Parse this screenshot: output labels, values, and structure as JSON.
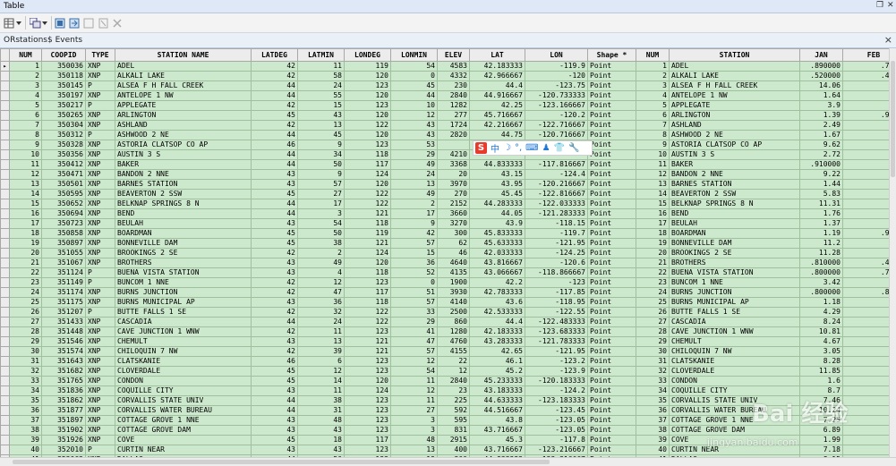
{
  "window": {
    "title": "Table"
  },
  "tab": {
    "title": "ORstations$ Events",
    "close": "×"
  },
  "ime": {
    "logo": "S",
    "items": [
      "中",
      "☽",
      "°,",
      "⌨",
      "♟",
      "👕",
      "🔧"
    ]
  },
  "watermark": {
    "text": "Bai 经验",
    "url": "jingyan.baidu.com"
  },
  "columns": [
    "NUM",
    "COOPID",
    "TYPE",
    "STATION NAME",
    "LATDEG",
    "LATMIN",
    "LONDEG",
    "LONMIN",
    "ELEV",
    "LAT",
    "LON",
    "Shape *",
    "NUM",
    "STATION",
    "JAN",
    "FEB"
  ],
  "rows": [
    [
      "1",
      "350036",
      "XNP",
      "ADEL",
      "42",
      "11",
      "119",
      "54",
      "4583",
      "42.183333",
      "-119.9",
      "Point",
      "1",
      "ADEL",
      ".890000",
      ".7900"
    ],
    [
      "2",
      "350118",
      "XNP",
      "ALKALI LAKE",
      "42",
      "58",
      "120",
      "0",
      "4332",
      "42.966667",
      "-120",
      "Point",
      "2",
      "ALKALI LAKE",
      ".520000",
      ".4600"
    ],
    [
      "3",
      "350145",
      "P",
      "ALSEA F H FALL CREEK",
      "44",
      "24",
      "123",
      "45",
      "230",
      "44.4",
      "-123.75",
      "Point",
      "3",
      "ALSEA F H FALL CREEK",
      "14.06",
      "12."
    ],
    [
      "4",
      "350197",
      "XNP",
      "ANTELOPE 1 NW",
      "44",
      "55",
      "120",
      "44",
      "2840",
      "44.916667",
      "-120.733333",
      "Point",
      "4",
      "ANTELOPE 1 NW",
      "1.64",
      "1."
    ],
    [
      "5",
      "350217",
      "P",
      "APPLEGATE",
      "42",
      "15",
      "123",
      "10",
      "1282",
      "42.25",
      "-123.166667",
      "Point",
      "5",
      "APPLEGATE",
      "3.9",
      "3."
    ],
    [
      "6",
      "350265",
      "XNP",
      "ARLINGTON",
      "45",
      "43",
      "120",
      "12",
      "277",
      "45.716667",
      "-120.2",
      "Point",
      "6",
      "ARLINGTON",
      "1.39",
      ".9900"
    ],
    [
      "7",
      "350304",
      "XNP",
      "ASHLAND",
      "42",
      "13",
      "122",
      "43",
      "1724",
      "42.216667",
      "-122.716667",
      "Point",
      "7",
      "ASHLAND",
      "2.49",
      "1."
    ],
    [
      "8",
      "350312",
      "P",
      "ASHWOOD 2 NE",
      "44",
      "45",
      "120",
      "43",
      "2820",
      "44.75",
      "-120.716667",
      "Point",
      "8",
      "ASHWOOD 2 NE",
      "1.67",
      "1."
    ],
    [
      "9",
      "350328",
      "XNP",
      "ASTORIA CLATSOP CO AP",
      "46",
      "9",
      "123",
      "53",
      "",
      "",
      "",
      "Point",
      "9",
      "ASTORIA CLATSOP CO AP",
      "9.62",
      "7."
    ],
    [
      "10",
      "350356",
      "XNP",
      "AUSTIN 3 S",
      "44",
      "34",
      "118",
      "29",
      "4210",
      "",
      "",
      "Point",
      "10",
      "AUSTIN 3 S",
      "2.72",
      "1."
    ],
    [
      "11",
      "350412",
      "XNP",
      "BAKER",
      "44",
      "50",
      "117",
      "49",
      "3368",
      "44.833333",
      "-117.816667",
      "Point",
      "11",
      "BAKER",
      ".910000",
      ""
    ],
    [
      "12",
      "350471",
      "XNP",
      "BANDON 2 NNE",
      "43",
      "9",
      "124",
      "24",
      "20",
      "43.15",
      "-124.4",
      "Point",
      "12",
      "BANDON 2 NNE",
      "9.22",
      "7."
    ],
    [
      "13",
      "350501",
      "XNP",
      "BARNES STATION",
      "43",
      "57",
      "120",
      "13",
      "3970",
      "43.95",
      "-120.216667",
      "Point",
      "13",
      "BARNES STATION",
      "1.44",
      "1."
    ],
    [
      "14",
      "350595",
      "XNP",
      "BEAVERTON 2 SSW",
      "45",
      "27",
      "122",
      "49",
      "270",
      "45.45",
      "-122.816667",
      "Point",
      "14",
      "BEAVERTON 2 SSW",
      "5.83",
      "4."
    ],
    [
      "15",
      "350652",
      "XNP",
      "BELKNAP SPRINGS 8 N",
      "44",
      "17",
      "122",
      "2",
      "2152",
      "44.283333",
      "-122.033333",
      "Point",
      "15",
      "BELKNAP SPRINGS 8 N",
      "11.31",
      "9."
    ],
    [
      "16",
      "350694",
      "XNP",
      "BEND",
      "44",
      "3",
      "121",
      "17",
      "3660",
      "44.05",
      "-121.283333",
      "Point",
      "16",
      "BEND",
      "1.76",
      "1."
    ],
    [
      "17",
      "350723",
      "XNP",
      "BEULAH",
      "43",
      "54",
      "118",
      "9",
      "3270",
      "43.9",
      "-118.15",
      "Point",
      "17",
      "BEULAH",
      "1.37",
      "1."
    ],
    [
      "18",
      "350858",
      "XNP",
      "BOARDMAN",
      "45",
      "50",
      "119",
      "42",
      "300",
      "45.833333",
      "-119.7",
      "Point",
      "18",
      "BOARDMAN",
      "1.19",
      ".9100"
    ],
    [
      "19",
      "350897",
      "XNP",
      "BONNEVILLE DAM",
      "45",
      "38",
      "121",
      "57",
      "62",
      "45.633333",
      "-121.95",
      "Point",
      "19",
      "BONNEVILLE DAM",
      "11.2",
      "9."
    ],
    [
      "20",
      "351055",
      "XNP",
      "BROOKINGS 2 SE",
      "42",
      "2",
      "124",
      "15",
      "46",
      "42.033333",
      "-124.25",
      "Point",
      "20",
      "BROOKINGS 2 SE",
      "11.28",
      "10."
    ],
    [
      "21",
      "351067",
      "XNP",
      "BROTHERS",
      "43",
      "49",
      "120",
      "36",
      "4640",
      "43.816667",
      "-120.6",
      "Point",
      "21",
      "BROTHERS",
      ".810000",
      ".4300"
    ],
    [
      "22",
      "351124",
      "P",
      "BUENA VISTA STATION",
      "43",
      "4",
      "118",
      "52",
      "4135",
      "43.066667",
      "-118.866667",
      "Point",
      "22",
      "BUENA VISTA STATION",
      ".800000",
      ".7900"
    ],
    [
      "23",
      "351149",
      "P",
      "BUNCOM 1 NNE",
      "42",
      "12",
      "123",
      "0",
      "1900",
      "42.2",
      "-123",
      "Point",
      "23",
      "BUNCOM 1 NNE",
      "3.42",
      "2."
    ],
    [
      "24",
      "351174",
      "XNP",
      "BURNS JUNCTION",
      "42",
      "47",
      "117",
      "51",
      "3930",
      "42.783333",
      "-117.85",
      "Point",
      "24",
      "BURNS JUNCTION",
      ".800000",
      ".8400"
    ],
    [
      "25",
      "351175",
      "XNP",
      "BURNS MUNICIPAL AP",
      "43",
      "36",
      "118",
      "57",
      "4140",
      "43.6",
      "-118.95",
      "Point",
      "25",
      "BURNS MUNICIPAL AP",
      "1.18",
      "1."
    ],
    [
      "26",
      "351207",
      "P",
      "BUTTE FALLS 1 SE",
      "42",
      "32",
      "122",
      "33",
      "2500",
      "42.533333",
      "-122.55",
      "Point",
      "26",
      "BUTTE FALLS 1 SE",
      "4.29",
      "4."
    ],
    [
      "27",
      "351433",
      "XNP",
      "CASCADIA",
      "44",
      "24",
      "122",
      "29",
      "860",
      "44.4",
      "-122.483333",
      "Point",
      "27",
      "CASCADIA",
      "8.24",
      "6."
    ],
    [
      "28",
      "351448",
      "XNP",
      "CAVE JUNCTION 1 WNW",
      "42",
      "11",
      "123",
      "41",
      "1280",
      "42.183333",
      "-123.683333",
      "Point",
      "28",
      "CAVE JUNCTION 1 WNW",
      "10.81",
      "9."
    ],
    [
      "29",
      "351546",
      "XNP",
      "CHEMULT",
      "43",
      "13",
      "121",
      "47",
      "4760",
      "43.283333",
      "-121.783333",
      "Point",
      "29",
      "CHEMULT",
      "4.67",
      "4."
    ],
    [
      "30",
      "351574",
      "XNP",
      "CHILOQUIN 7 NW",
      "42",
      "39",
      "121",
      "57",
      "4155",
      "42.65",
      "-121.95",
      "Point",
      "30",
      "CHILOQUIN 7 NW",
      "3.05",
      "2."
    ],
    [
      "31",
      "351643",
      "XNP",
      "CLATSKANIE",
      "46",
      "6",
      "123",
      "12",
      "22",
      "46.1",
      "-123.2",
      "Point",
      "31",
      "CLATSKANIE",
      "8.28",
      "6."
    ],
    [
      "32",
      "351682",
      "XNP",
      "CLOVERDALE",
      "45",
      "12",
      "123",
      "54",
      "12",
      "45.2",
      "-123.9",
      "Point",
      "32",
      "CLOVERDALE",
      "11.85",
      "9."
    ],
    [
      "33",
      "351765",
      "XNP",
      "CONDON",
      "45",
      "14",
      "120",
      "11",
      "2840",
      "45.233333",
      "-120.183333",
      "Point",
      "33",
      "CONDON",
      "1.6",
      "1."
    ],
    [
      "34",
      "351836",
      "XNP",
      "COQUILLE CITY",
      "43",
      "11",
      "124",
      "12",
      "23",
      "43.183333",
      "-124.2",
      "Point",
      "34",
      "COQUILLE CITY",
      "8.7",
      "7."
    ],
    [
      "35",
      "351862",
      "XNP",
      "CORVALLIS STATE UNIV",
      "44",
      "38",
      "123",
      "11",
      "225",
      "44.633333",
      "-123.183333",
      "Point",
      "35",
      "CORVALLIS STATE UNIV",
      "7.46",
      "5."
    ],
    [
      "36",
      "351877",
      "XNP",
      "CORVALLIS WATER BUREAU",
      "44",
      "31",
      "123",
      "27",
      "592",
      "44.516667",
      "-123.45",
      "Point",
      "36",
      "CORVALLIS WATER BUREAU",
      "10.24",
      "8."
    ],
    [
      "37",
      "351897",
      "XNP",
      "COTTAGE GROVE 1 NNE",
      "43",
      "48",
      "123",
      "3",
      "595",
      "43.8",
      "-123.05",
      "Point",
      "37",
      "COTTAGE GROVE 1 NNE",
      "7.25",
      "5."
    ],
    [
      "38",
      "351902",
      "XNP",
      "COTTAGE GROVE DAM",
      "43",
      "43",
      "123",
      "3",
      "831",
      "43.716667",
      "-123.05",
      "Point",
      "38",
      "COTTAGE GROVE DAM",
      "6.89",
      "5."
    ],
    [
      "39",
      "351926",
      "XNP",
      "COVE",
      "45",
      "18",
      "117",
      "48",
      "2915",
      "45.3",
      "-117.8",
      "Point",
      "39",
      "COVE",
      "1.99",
      "1."
    ],
    [
      "40",
      "352010",
      "P",
      "CURTIN NEAR",
      "43",
      "43",
      "123",
      "13",
      "400",
      "43.716667",
      "-123.216667",
      "Point",
      "40",
      "CURTIN NEAR",
      "7.18",
      "6."
    ],
    [
      "41",
      "352062",
      "XNP",
      "DALLAS",
      "44",
      "56",
      "123",
      "19",
      "300",
      "44.933333",
      "-123.316667",
      "Point",
      "41",
      "DALLAS",
      "8.15",
      "6."
    ]
  ]
}
